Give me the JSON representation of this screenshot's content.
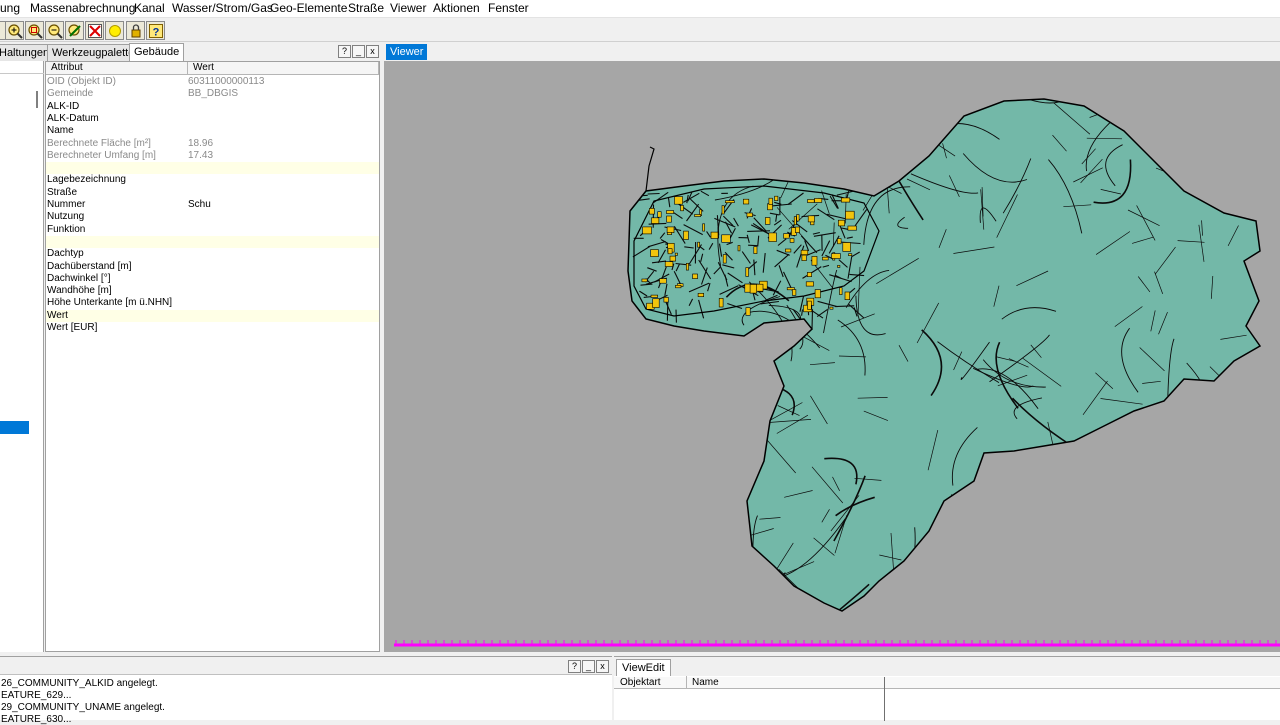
{
  "menu": {
    "items": [
      "ung",
      "Massenabrechnung",
      "Kanal",
      "Wasser/Strom/Gas",
      "Geo-Elemente",
      "Straße",
      "Viewer",
      "Aktionen",
      "Fenster"
    ]
  },
  "toolbar": {
    "icons": [
      "zoom-in-icon",
      "zoom-window-icon",
      "zoom-out-icon",
      "pan-icon",
      "delete-icon",
      "highlight-icon",
      "lock-icon",
      "help-icon"
    ]
  },
  "left_panel": {
    "tabs": [
      "Haltungen",
      "Werkzeugpalette",
      "Gebäude"
    ],
    "active_tab": "Gebäude",
    "controls": {
      "help": "?",
      "minimize": "_",
      "close": "x"
    },
    "grid": {
      "columns": [
        "Attribut",
        "Wert"
      ],
      "rows": [
        {
          "key": "OID (Objekt ID)",
          "value": "60311000000113",
          "readonly": true,
          "highlight": false
        },
        {
          "key": "Gemeinde",
          "value": "BB_DBGIS",
          "readonly": true,
          "highlight": false
        },
        {
          "key": "ALK-ID",
          "value": "",
          "readonly": false,
          "highlight": false
        },
        {
          "key": "ALK-Datum",
          "value": "",
          "readonly": false,
          "highlight": false
        },
        {
          "key": "Name",
          "value": "",
          "readonly": false,
          "highlight": false
        },
        {
          "key": "Berechnete Fläche [m²]",
          "value": "18.96",
          "readonly": true,
          "highlight": false
        },
        {
          "key": "Berechneter Umfang [m]",
          "value": "17.43",
          "readonly": true,
          "highlight": false
        },
        {
          "key": "",
          "value": "",
          "readonly": false,
          "highlight": true
        },
        {
          "key": "Lagebezeichnung",
          "value": "",
          "readonly": false,
          "highlight": false
        },
        {
          "key": "Straße",
          "value": "",
          "readonly": false,
          "highlight": false
        },
        {
          "key": "Nummer",
          "value": "Schu",
          "readonly": false,
          "highlight": false
        },
        {
          "key": "Nutzung",
          "value": "",
          "readonly": false,
          "highlight": false
        },
        {
          "key": "Funktion",
          "value": "",
          "readonly": false,
          "highlight": false
        },
        {
          "key": "",
          "value": "",
          "readonly": false,
          "highlight": true
        },
        {
          "key": "Dachtyp",
          "value": "",
          "readonly": false,
          "highlight": false
        },
        {
          "key": "Dachüberstand [m]",
          "value": "",
          "readonly": false,
          "highlight": false
        },
        {
          "key": "Dachwinkel [°]",
          "value": "",
          "readonly": false,
          "highlight": false
        },
        {
          "key": "Wandhöhe [m]",
          "value": "",
          "readonly": false,
          "highlight": false
        },
        {
          "key": "Höhe Unterkante [m ü.NHN]",
          "value": "",
          "readonly": false,
          "highlight": false
        },
        {
          "key": "Wert",
          "value": "",
          "readonly": false,
          "highlight": true
        },
        {
          "key": "Wert [EUR]",
          "value": "",
          "readonly": false,
          "highlight": false
        }
      ]
    }
  },
  "viewer": {
    "tab_label": "Viewer",
    "map_fill": "#73b8a8",
    "building_fill": "#f2c40c",
    "background": "#a6a6a6",
    "ruler_color": "#ff00ff"
  },
  "log_panel": {
    "controls": {
      "help": "?",
      "minimize": "_",
      "close": "x"
    },
    "lines": [
      "26_COMMUNITY_ALKID angelegt.",
      "EATURE_629...",
      "29_COMMUNITY_UNAME angelegt.",
      "EATURE_630..."
    ]
  },
  "viewedit": {
    "tab_label": "ViewEdit",
    "columns": [
      "Objektart",
      "Name"
    ]
  }
}
